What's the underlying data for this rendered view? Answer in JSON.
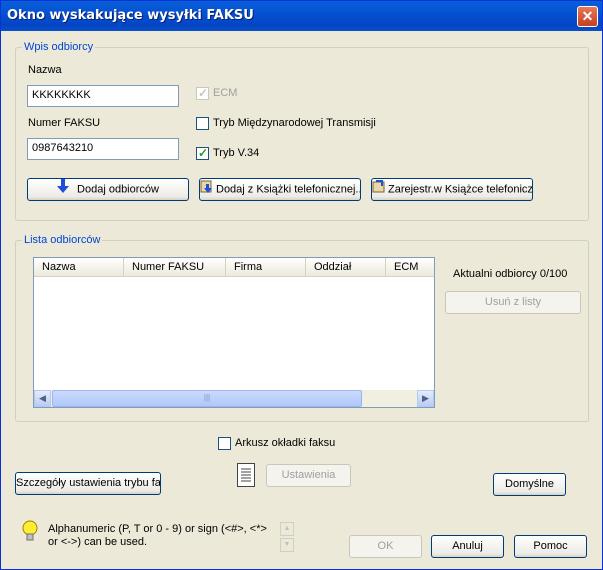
{
  "window": {
    "title": "Okno wyskakujące wysyłki FAKSU",
    "close_symbol": "✕"
  },
  "recipient_entry": {
    "legend": "Wpis odbiorcy",
    "name_label": "Nazwa",
    "name_value": "KKKKKKKK",
    "fax_label": "Numer FAKSU",
    "fax_value": "0987643210",
    "ecm_label": "ECM",
    "ecm_checked": true,
    "ecm_enabled": false,
    "intl_label": "Tryb Międzynarodowej Transmisji",
    "intl_checked": false,
    "v34_label": "Tryb V.34",
    "v34_checked": true,
    "add_recipients_label": "Dodaj odbiorców",
    "add_from_phonebook_label": "Dodaj z Książki telefonicznej...",
    "register_phonebook_label": "Zarejestr.w Książce telefonicznej"
  },
  "recipient_list": {
    "legend": "Lista odbiorców",
    "columns": [
      "Nazwa",
      "Numer FAKSU",
      "Firma",
      "Oddział",
      "ECM"
    ],
    "current_count_label": "Aktualni odbiorcy 0/100",
    "remove_label": "Usuń z listy",
    "scroll_grip": "|||"
  },
  "cover_sheet_label": "Arkusz okładki faksu",
  "settings_label": "Ustawienia",
  "fax_mode_details_label": "Szczegóły ustawienia trybu faksu",
  "defaults_label": "Domyślne",
  "hint_text": "Alphanumeric (P, T or 0 - 9) or sign (<#>, <*> or <->) can be used.",
  "ok_label": "OK",
  "cancel_label": "Anuluj",
  "help_label": "Pomoc",
  "colors": {
    "title_bar": "#0552d3",
    "legend": "#0046d5",
    "dialog_bg": "#ece9d8"
  }
}
